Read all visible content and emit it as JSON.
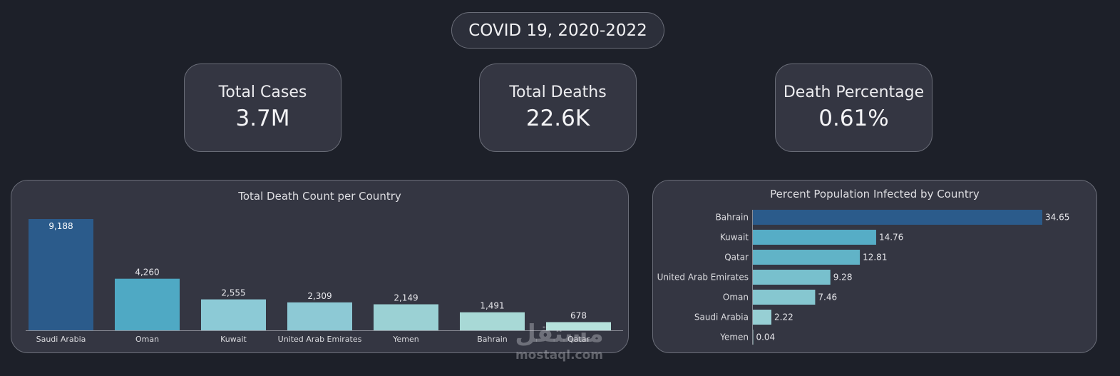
{
  "header": {
    "title": "COVID 19, 2020-2022"
  },
  "kpis": [
    {
      "label": "Total Cases",
      "value": "3.7M"
    },
    {
      "label": "Total Deaths",
      "value": "22.6K"
    },
    {
      "label": "Death Percentage",
      "value": "0.61%"
    }
  ],
  "chart_data": [
    {
      "type": "bar",
      "title": "Total Death Count per Country",
      "categories": [
        "Saudi Arabia",
        "Oman",
        "Kuwait",
        "United Arab Emirates",
        "Yemen",
        "Bahrain",
        "Qatar"
      ],
      "values": [
        9188,
        4260,
        2555,
        2309,
        2149,
        1491,
        678
      ],
      "value_labels": [
        "9,188",
        "4,260",
        "2,555",
        "2,309",
        "2,149",
        "1,491",
        "678"
      ],
      "colors": [
        "#2b5b8b",
        "#4fa9c4",
        "#8ccad6",
        "#8dc9d5",
        "#9bd1d4",
        "#a8d9d6",
        "#b6e2dc"
      ],
      "ylim": [
        0,
        9188
      ],
      "grid": false,
      "orientation": "vertical"
    },
    {
      "type": "bar",
      "title": "Percent Population Infected by Country",
      "categories": [
        "Bahrain",
        "Kuwait",
        "Qatar",
        "United Arab Emirates",
        "Oman",
        "Saudi Arabia",
        "Yemen"
      ],
      "values": [
        34.65,
        14.76,
        12.81,
        9.28,
        7.46,
        2.22,
        0.04
      ],
      "value_labels": [
        "34.65",
        "14.76",
        "12.81",
        "9.28",
        "7.46",
        "2.22",
        "0.04"
      ],
      "colors": [
        "#2b5b8b",
        "#56adc6",
        "#61b3c7",
        "#78c0cd",
        "#86c7d0",
        "#97cfd4",
        "#a8d9d6"
      ],
      "xlim": [
        0,
        34.65
      ],
      "grid": false,
      "orientation": "horizontal"
    }
  ],
  "watermark": {
    "arabic": "مستقل",
    "latin": "mostaql.com"
  }
}
